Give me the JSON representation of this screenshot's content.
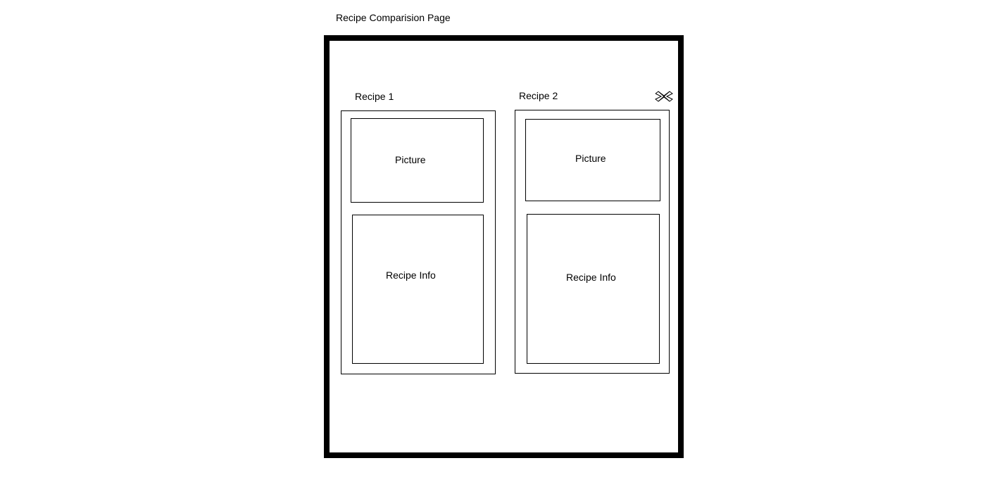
{
  "page": {
    "title": "Recipe Comparision Page"
  },
  "recipes": [
    {
      "label": "Recipe 1",
      "picture_label": "Picture",
      "info_label": "Recipe Info"
    },
    {
      "label": "Recipe 2",
      "picture_label": "Picture",
      "info_label": "Recipe Info"
    }
  ],
  "icons": {
    "close": "close-icon"
  },
  "colors": {
    "frame": "#000000",
    "background": "#ffffff",
    "text": "#000000"
  }
}
